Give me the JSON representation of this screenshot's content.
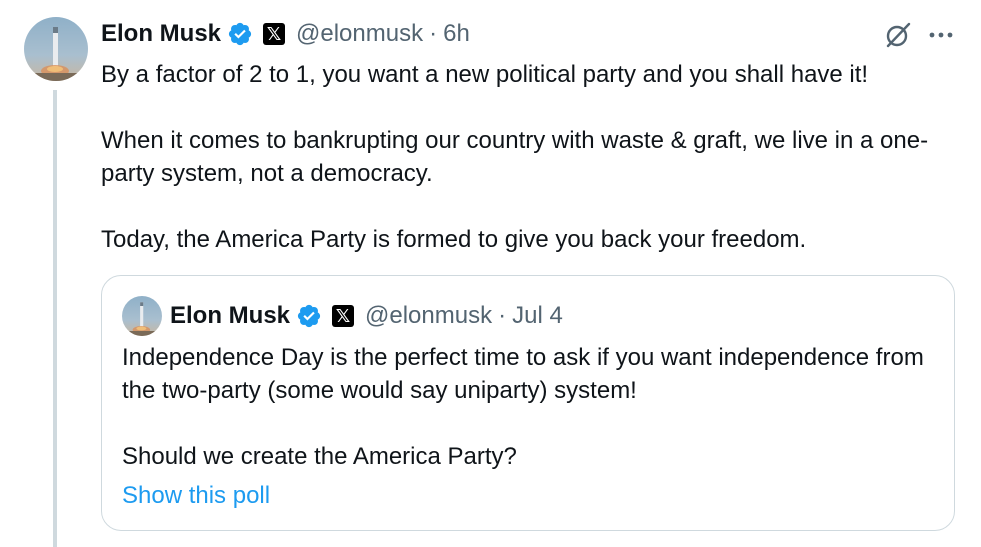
{
  "tweet": {
    "author_name": "Elon Musk",
    "handle": "@elonmusk",
    "separator": "·",
    "time": "6h",
    "paragraphs": [
      "By a factor of 2 to 1, you want a new political party and you shall have it!",
      "When it comes to bankrupting our country with waste & graft, we live in a one-party system, not a democracy.",
      "Today, the America Party is formed to give you back your freedom."
    ],
    "badge_letter": "𝕏",
    "more_label": "•••"
  },
  "quote": {
    "author_name": "Elon Musk",
    "handle": "@elonmusk",
    "separator": "·",
    "time": "Jul 4",
    "paragraphs": [
      "Independence Day is the perfect time to ask if you want independence from the two-party (some would say uniparty) system!",
      "Should we create the America Party?"
    ],
    "poll_link": "Show this poll",
    "badge_letter": "𝕏"
  },
  "colors": {
    "verified_blue": "#1d9bf0",
    "link_blue": "#1d9bf0",
    "secondary_text": "#536471",
    "border": "#cfd9de"
  },
  "icons": {
    "verified": "verified-checkmark-icon",
    "affiliate": "x-logo-icon",
    "grok": "grok-icon",
    "more": "more-options-icon"
  }
}
